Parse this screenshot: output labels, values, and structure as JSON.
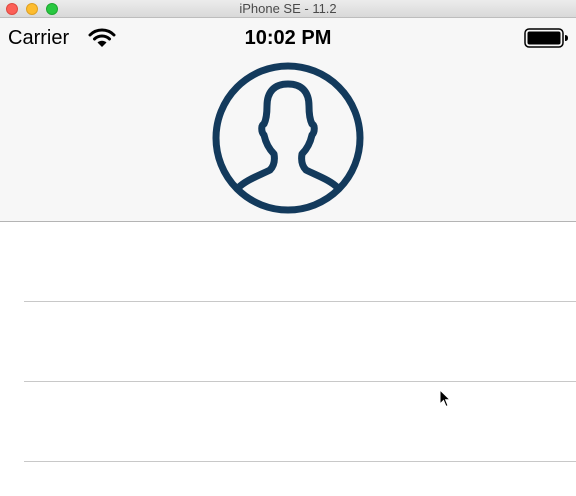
{
  "window": {
    "title": "iPhone SE - 11.2"
  },
  "status_bar": {
    "carrier": "Carrier",
    "time": "10:02 PM",
    "icons": [
      "wifi-icon",
      "battery-icon"
    ]
  },
  "header": {
    "avatar_icon": "user-avatar-icon",
    "avatar_color": "#133a5c"
  },
  "table": {
    "rows": [
      {
        "label": ""
      },
      {
        "label": ""
      },
      {
        "label": ""
      }
    ]
  },
  "colors": {
    "header_background": "#f7f7f7",
    "separator": "#c8c8c8",
    "close": "#fc5f57",
    "minimize": "#fdbc2e",
    "maximize": "#28c840"
  }
}
